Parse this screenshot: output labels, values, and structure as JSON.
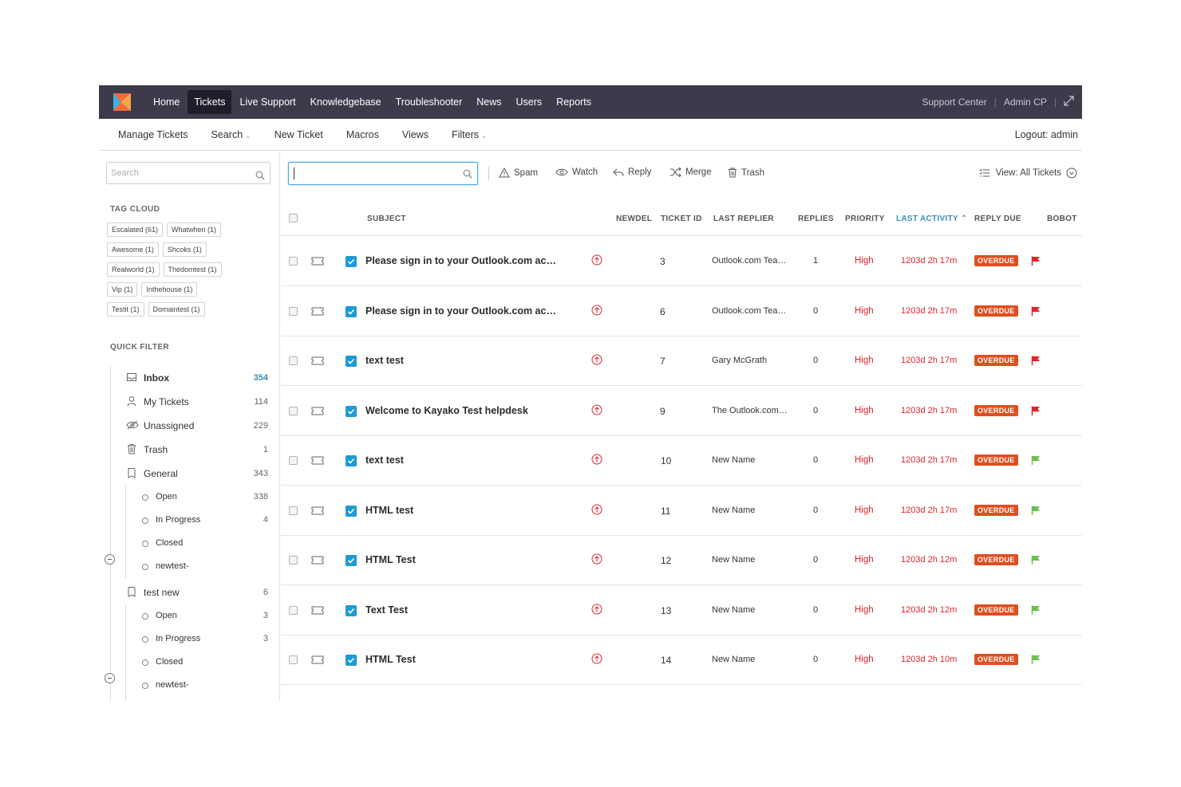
{
  "nav": {
    "items": [
      "Home",
      "Tickets",
      "Live Support",
      "Knowledgebase",
      "Troubleshooter",
      "News",
      "Users",
      "Reports"
    ],
    "active": "Tickets",
    "support_center": "Support Center",
    "admin_cp": "Admin CP"
  },
  "subnav": {
    "manage": "Manage Tickets",
    "search": "Search",
    "new_ticket": "New Ticket",
    "macros": "Macros",
    "views": "Views",
    "filters": "Filters",
    "logout": "Logout: admin"
  },
  "sidebar": {
    "search_placeholder": "Search",
    "tag_cloud_title": "TAG CLOUD",
    "tags": [
      [
        "Escalated (61)",
        "Whatwhen (1)"
      ],
      [
        "Awesome (1)",
        "Shcoks (1)"
      ],
      [
        "Realworld (1)",
        "Thedomtest (1)"
      ],
      [
        "Vip (1)",
        "Inthehouse (1)"
      ],
      [
        "Testit (1)",
        "Domaintest (1)"
      ]
    ],
    "quick_filter_title": "QUICK FILTER",
    "inbox": {
      "label": "Inbox",
      "count": "354"
    },
    "my_tickets": {
      "label": "My Tickets",
      "count": "114"
    },
    "unassigned": {
      "label": "Unassigned",
      "count": "229"
    },
    "trash": {
      "label": "Trash",
      "count": "1"
    },
    "general": {
      "label": "General",
      "count": "343",
      "children": [
        {
          "label": "Open",
          "count": "338"
        },
        {
          "label": "In Progress",
          "count": "4"
        },
        {
          "label": "Closed",
          "count": ""
        },
        {
          "label": "newtest-",
          "count": ""
        }
      ]
    },
    "test_new": {
      "label": "test new",
      "count": "6",
      "children": [
        {
          "label": "Open",
          "count": "3"
        },
        {
          "label": "In Progress",
          "count": "3"
        },
        {
          "label": "Closed",
          "count": ""
        },
        {
          "label": "newtest-",
          "count": ""
        }
      ]
    }
  },
  "toolbar": {
    "spam": "Spam",
    "watch": "Watch",
    "reply": "Reply",
    "merge": "Merge",
    "trash": "Trash",
    "view_all": "View: All Tickets"
  },
  "table": {
    "headers": {
      "subject": "SUBJECT",
      "newdel": "NEWDEL",
      "ticket_id": "TICKET ID",
      "last_replier": "LAST REPLIER",
      "replies": "REPLIES",
      "priority": "PRIORITY",
      "last_activity": "LAST ACTIVITY",
      "reply_due": "REPLY DUE",
      "bobot": "BOBOT"
    },
    "rows": [
      {
        "subject": "Please sign in to your Outlook.com ac…",
        "id": "3",
        "replier": "Outlook.com Tea…",
        "replies": "1",
        "priority": "High",
        "activity": "1203d 2h 17m",
        "due": "OVERDUE",
        "flag": "#e0242b"
      },
      {
        "subject": "Please sign in to your Outlook.com ac…",
        "id": "6",
        "replier": "Outlook.com Tea…",
        "replies": "0",
        "priority": "High",
        "activity": "1203d 2h 17m",
        "due": "OVERDUE",
        "flag": "#e0242b"
      },
      {
        "subject": "text test",
        "id": "7",
        "replier": "Gary McGrath",
        "replies": "0",
        "priority": "High",
        "activity": "1203d 2h 17m",
        "due": "OVERDUE",
        "flag": "#e0242b"
      },
      {
        "subject": "Welcome to Kayako Test helpdesk",
        "id": "9",
        "replier": "The Outlook.com…",
        "replies": "0",
        "priority": "High",
        "activity": "1203d 2h 17m",
        "due": "OVERDUE",
        "flag": "#e0242b"
      },
      {
        "subject": "text test",
        "id": "10",
        "replier": "New Name",
        "replies": "0",
        "priority": "High",
        "activity": "1203d 2h 17m",
        "due": "OVERDUE",
        "flag": "#6bbf4e"
      },
      {
        "subject": "HTML test",
        "id": "11",
        "replier": "New Name",
        "replies": "0",
        "priority": "High",
        "activity": "1203d 2h 17m",
        "due": "OVERDUE",
        "flag": "#6bbf4e"
      },
      {
        "subject": "HTML Test",
        "id": "12",
        "replier": "New Name",
        "replies": "0",
        "priority": "High",
        "activity": "1203d 2h 12m",
        "due": "OVERDUE",
        "flag": "#6bbf4e"
      },
      {
        "subject": "Text Test",
        "id": "13",
        "replier": "New Name",
        "replies": "0",
        "priority": "High",
        "activity": "1203d 2h 12m",
        "due": "OVERDUE",
        "flag": "#6bbf4e"
      },
      {
        "subject": "HTML Test",
        "id": "14",
        "replier": "New Name",
        "replies": "0",
        "priority": "High",
        "activity": "1203d 2h 10m",
        "due": "OVERDUE",
        "flag": "#6bbf4e"
      }
    ]
  },
  "colors": {
    "topbar": "#3d3a4b",
    "accent": "#1e9ad6",
    "overdue": "#e04e1f",
    "high": "#e0242b"
  }
}
